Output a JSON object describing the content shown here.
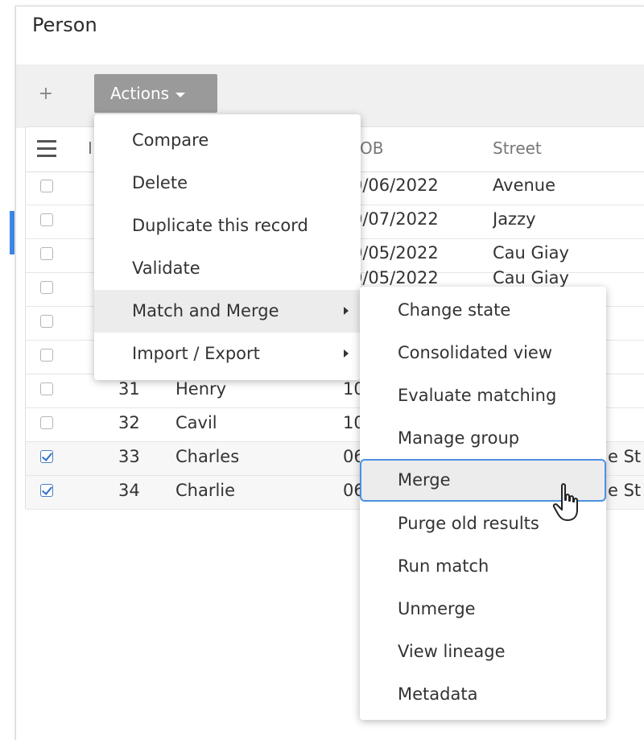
{
  "page": {
    "title": "Person"
  },
  "toolbar": {
    "add_label": "+",
    "actions_label": "Actions"
  },
  "grid": {
    "columns": [
      "I",
      "OB",
      "Street"
    ],
    "rows": [
      {
        "id": "",
        "name": "",
        "dob": "0/06/2022",
        "street": "Avenue",
        "checked": false
      },
      {
        "id": "",
        "name": "",
        "dob": "0/07/2022",
        "street": "Jazzy",
        "checked": false
      },
      {
        "id": "",
        "name": "",
        "dob": "0/05/2022",
        "street": "Cau Giay",
        "checked": false
      },
      {
        "id": "",
        "name": "",
        "dob": "0/05/2022",
        "street": "Cau Giay",
        "checked": false
      },
      {
        "id": "",
        "name": "",
        "dob": "",
        "street": "",
        "checked": false
      },
      {
        "id": "",
        "name": "",
        "dob": "",
        "street": "",
        "checked": false
      },
      {
        "id": "31",
        "name": "Henry",
        "dob": "10",
        "street": "",
        "checked": false
      },
      {
        "id": "32",
        "name": "Cavil",
        "dob": "10",
        "street": "",
        "checked": false
      },
      {
        "id": "33",
        "name": "Charles",
        "dob": "06",
        "street": "e St",
        "checked": true
      },
      {
        "id": "34",
        "name": "Charlie",
        "dob": "06",
        "street": "e St",
        "checked": true
      }
    ]
  },
  "actions_menu": {
    "items": [
      "Compare",
      "Delete",
      "Duplicate this record",
      "Validate",
      "Match and Merge",
      "Import / Export"
    ],
    "hovered": "Match and Merge"
  },
  "submenu": {
    "items": [
      "Change state",
      "Consolidated view",
      "Evaluate matching",
      "Manage group",
      "Merge",
      "Purge old results",
      "Run match",
      "Unmerge",
      "View lineage",
      "Metadata"
    ],
    "focused": "Merge"
  },
  "colors": {
    "accent": "#4a90e2",
    "toolbar_bg": "#f0f0f0",
    "actions_bg": "#9a9a9a",
    "hover_bg": "#ececec"
  }
}
